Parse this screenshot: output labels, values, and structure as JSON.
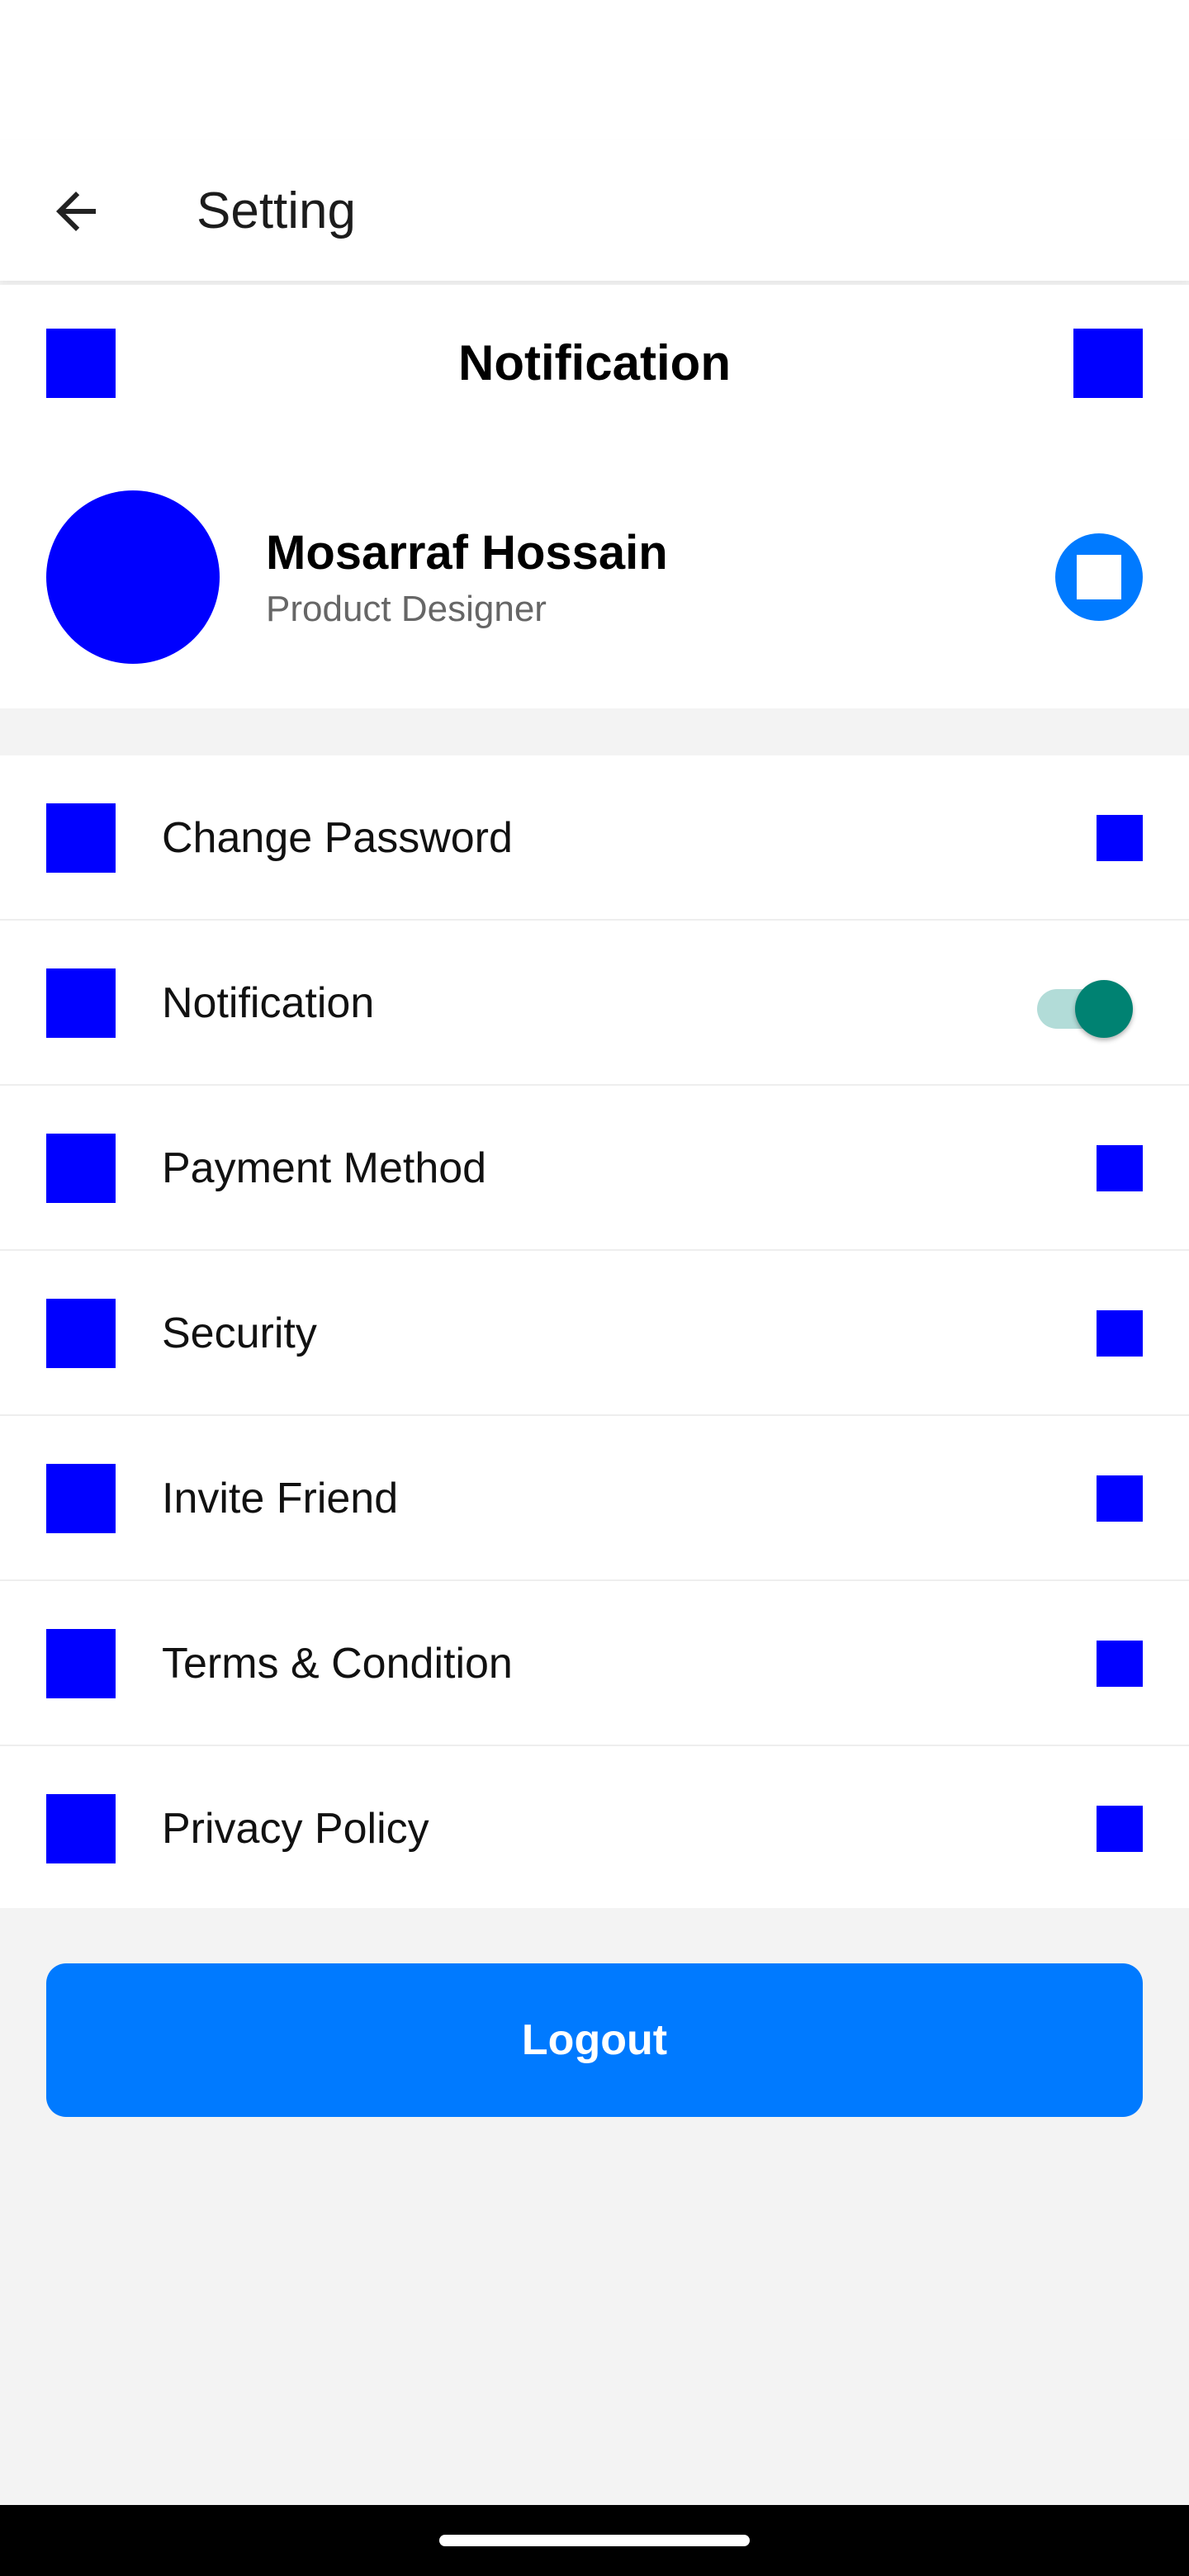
{
  "header": {
    "title": "Setting",
    "back_icon": "arrow-left-icon"
  },
  "notification_bar": {
    "title": "Notification"
  },
  "profile": {
    "name": "Mosarraf Hossain",
    "role": "Product Designer",
    "edit_icon": "edit-icon"
  },
  "menu": [
    {
      "label": "Change Password",
      "type": "link"
    },
    {
      "label": "Notification",
      "type": "toggle",
      "on": true
    },
    {
      "label": "Payment Method",
      "type": "link"
    },
    {
      "label": "Security",
      "type": "link"
    },
    {
      "label": "Invite Friend",
      "type": "link"
    },
    {
      "label": "Terms & Condition",
      "type": "link"
    },
    {
      "label": "Privacy Policy",
      "type": "link"
    }
  ],
  "logout_label": "Logout",
  "colors": {
    "primary": "#007AFF",
    "placeholder_icon": "#0000FF",
    "toggle_on": "#008272",
    "background": "#F3F3F3"
  }
}
